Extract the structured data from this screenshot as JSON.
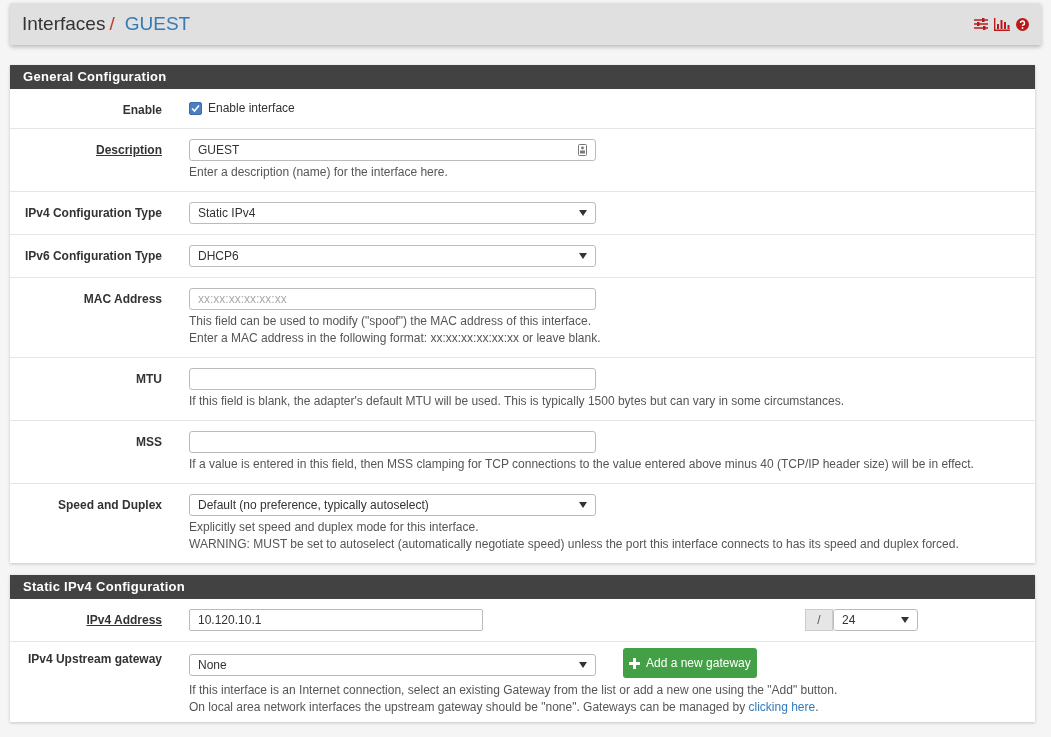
{
  "header": {
    "section": "Interfaces",
    "separator": "/",
    "current": "GUEST"
  },
  "panels": [
    {
      "title": "General Configuration",
      "rows": [
        {
          "kind": "checkbox",
          "label": "Enable",
          "link": false,
          "checked": true,
          "text": "Enable interface",
          "help": []
        },
        {
          "kind": "text",
          "label": "Description",
          "link": true,
          "value": "GUEST",
          "badge": true,
          "help": [
            {
              "text": "Enter a description (name) for the interface here."
            }
          ]
        },
        {
          "kind": "select",
          "label": "IPv4 Configuration Type",
          "link": false,
          "value": "Static IPv4",
          "help": []
        },
        {
          "kind": "select",
          "label": "IPv6 Configuration Type",
          "link": false,
          "value": "DHCP6",
          "help": []
        },
        {
          "kind": "text",
          "label": "MAC Address",
          "link": false,
          "placeholder": "xx:xx:xx:xx:xx:xx",
          "help": [
            {
              "text": "This field can be used to modify (\"spoof\") the MAC address of this interface."
            },
            {
              "text": "Enter a MAC address in the following format: xx:xx:xx:xx:xx:xx or leave blank."
            }
          ]
        },
        {
          "kind": "text",
          "label": "MTU",
          "link": false,
          "help": [
            {
              "text": "If this field is blank, the adapter's default MTU will be used. This is typically 1500 bytes but can vary in some circumstances."
            }
          ]
        },
        {
          "kind": "text",
          "label": "MSS",
          "link": false,
          "help": [
            {
              "text": "If a value is entered in this field, then MSS clamping for TCP connections to the value entered above minus 40 (TCP/IP header size) will be in effect."
            }
          ]
        },
        {
          "kind": "select",
          "label": "Speed and Duplex",
          "link": false,
          "value": "Default (no preference, typically autoselect)",
          "help": [
            {
              "text": "Explicitly set speed and duplex mode for this interface."
            },
            {
              "text": "WARNING: MUST be set to autoselect (automatically negotiate speed) unless the port this interface connects to has its speed and duplex forced."
            }
          ]
        }
      ]
    },
    {
      "title": "Static IPv4 Configuration",
      "rows": [
        {
          "kind": "address",
          "label": "IPv4 Address",
          "link": true,
          "value": "10.120.10.1",
          "addon": "/",
          "mask": "24",
          "help": []
        },
        {
          "kind": "gateway",
          "label": "IPv4 Upstream gateway",
          "link": false,
          "value": "None",
          "button": "Add a new gateway",
          "help": [
            {
              "text": "If this interface is an Internet connection, select an existing Gateway from the list or add a new one using the \"Add\" button."
            },
            {
              "text": "On local area network interfaces the upstream gateway should be \"none\". Gateways can be managed by ",
              "link": "clicking here",
              "after": "."
            }
          ]
        }
      ]
    }
  ]
}
